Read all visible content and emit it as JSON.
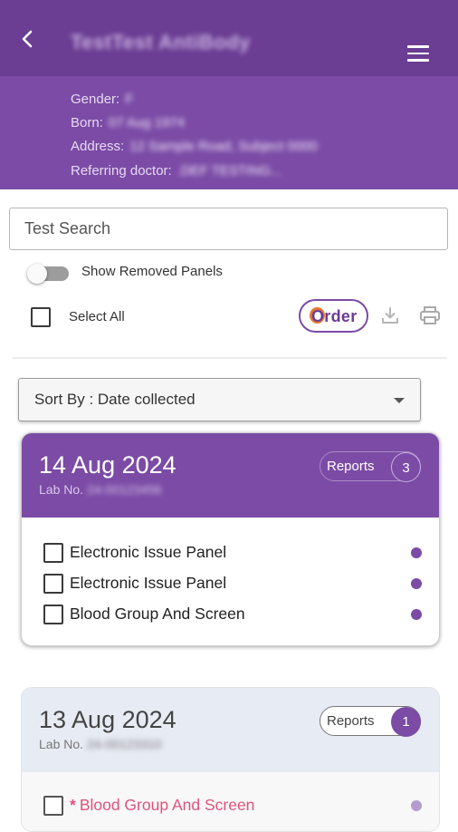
{
  "header": {
    "title": "TestTest AntiBody",
    "back_icon": "chevron-left-icon",
    "menu_icon": "hamburger-menu-icon"
  },
  "patient": {
    "gender_label": "Gender:",
    "gender_value": "F",
    "born_label": "Born:",
    "born_value": "07 Aug 1974",
    "address_label": "Address:",
    "address_value": "12 Sample Road, Subject 0000",
    "doctor_label": "Referring doctor:",
    "doctor_value": ".DEF TESTING..."
  },
  "search": {
    "placeholder": "Test Search"
  },
  "toggle": {
    "label": "Show Removed Panels",
    "state": "off"
  },
  "actions": {
    "select_all_label": "Select All",
    "order_label": "Order",
    "order_accent": "#e8762f",
    "download_icon": "download-icon",
    "print_icon": "printer-icon"
  },
  "sort": {
    "label": "Sort By : Date collected"
  },
  "cards": [
    {
      "date": "14 Aug 2024",
      "lab_label": "Lab No.",
      "lab_value": "24-00123456",
      "reports_label": "Reports",
      "reports_count": "3",
      "panels": [
        {
          "name": "Electronic Issue Panel"
        },
        {
          "name": "Electronic Issue Panel"
        },
        {
          "name": "Blood Group And Screen"
        }
      ]
    },
    {
      "date": "13 Aug 2024",
      "lab_label": "Lab No.",
      "lab_value": "24-00123310",
      "reports_label": "Reports",
      "reports_count": "1",
      "panels": [
        {
          "name": "Blood Group And Screen",
          "marker": "*"
        }
      ]
    }
  ],
  "colors": {
    "brand": "#7b4ba6",
    "brand_dark": "#6b3d93",
    "removed": "#e0527e"
  }
}
